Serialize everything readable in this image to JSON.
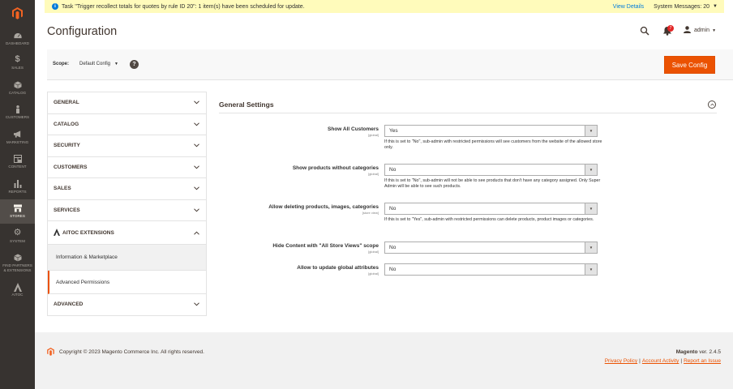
{
  "nav": {
    "items": [
      {
        "label": "DASHBOARD",
        "icon": "dashboard-icon"
      },
      {
        "label": "SALES",
        "icon": "dollar-icon"
      },
      {
        "label": "CATALOG",
        "icon": "cube-icon"
      },
      {
        "label": "CUSTOMERS",
        "icon": "person-icon"
      },
      {
        "label": "MARKETING",
        "icon": "megaphone-icon"
      },
      {
        "label": "CONTENT",
        "icon": "layout-icon"
      },
      {
        "label": "REPORTS",
        "icon": "bar-chart-icon"
      },
      {
        "label": "STORES",
        "icon": "store-icon"
      },
      {
        "label": "SYSTEM",
        "icon": "gear-icon"
      },
      {
        "label": "FIND PARTNERS & EXTENSIONS",
        "icon": "partners-cube-icon"
      },
      {
        "label": "AITOC",
        "icon": "aitoc-icon"
      }
    ]
  },
  "message": {
    "text": "Task \"Trigger recollect totals for quotes by rule ID 20\": 1 item(s) have been scheduled for update.",
    "view_details": "View Details",
    "system_messages": "System Messages: 20"
  },
  "header": {
    "title": "Configuration",
    "notifications_count": "7",
    "user": "admin"
  },
  "scope": {
    "label": "Scope:",
    "value": "Default Config",
    "help": "?",
    "save_label": "Save Config"
  },
  "tabs": {
    "general": "GENERAL",
    "catalog": "CATALOG",
    "security": "SECURITY",
    "customers": "CUSTOMERS",
    "sales": "SALES",
    "services": "SERVICES",
    "aitoc": "AITOC EXTENSIONS",
    "aitoc_sub": [
      "Information & Marketplace",
      "Advanced Permissions"
    ],
    "advanced": "ADVANCED"
  },
  "section": {
    "title": "General Settings",
    "fields": [
      {
        "label": "Show All Customers",
        "scope": "[global]",
        "value": "Yes",
        "note": "If this is set to \"No\", sub-admin with restricted permissions will see customers from the website of the allowed store only."
      },
      {
        "label": "Show products without categories",
        "scope": "[global]",
        "value": "No",
        "note": "If this is set to \"No\", sub-admin will not be able to see products that don't have any category assigned. Only Super Admin will be able to see such products."
      },
      {
        "label": "Allow deleting products, images, categories",
        "scope": "[store view]",
        "value": "No",
        "note": "If this is set to \"Yes\", sub-admin with restricted permissions can delete products, product images or categories."
      },
      {
        "label": "Hide Content with \"All Store Views\" scope",
        "scope": "[global]",
        "value": "No",
        "note": ""
      },
      {
        "label": "Allow to update global attributes",
        "scope": "[global]",
        "value": "No",
        "note": ""
      }
    ]
  },
  "footer": {
    "copyright": "Copyright © 2023 Magento Commerce Inc. All rights reserved.",
    "brand": "Magento",
    "version": "ver. 2.4.5",
    "links": [
      "Privacy Policy",
      "Account Activity",
      "Report an Issue"
    ]
  },
  "colors": {
    "accent": "#eb5202",
    "nav_bg": "#373330",
    "message_bg": "#fffbbb",
    "link": "#007bdb"
  }
}
